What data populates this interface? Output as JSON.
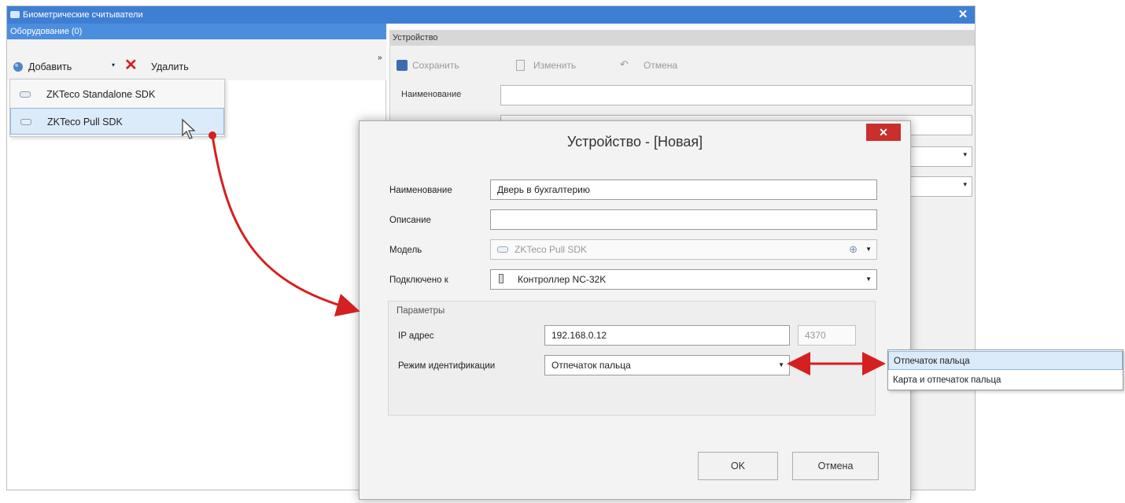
{
  "window": {
    "title": "Биометрические считыватели",
    "close_glyph": "✕"
  },
  "left_panel": {
    "header": "Оборудование (0)",
    "add_label": "Добавить",
    "delete_label": "Удалить",
    "overflow_glyph": "»",
    "menu_items": [
      {
        "label": "ZKTeco Standalone SDK",
        "icon": "device-icon"
      },
      {
        "label": "ZKTeco Pull SDK",
        "icon": "device-icon"
      }
    ]
  },
  "right_panel": {
    "header": "Устройство",
    "save_label": "Сохранить",
    "edit_label": "Изменить",
    "cancel_label": "Отмена",
    "name_label": "Наименование"
  },
  "dialog": {
    "title": "Устройство -  [Новая]",
    "close_glyph": "✕",
    "name_label": "Наименование",
    "name_value": "Дверь в бухгалтерию",
    "description_label": "Описание",
    "description_value": "",
    "model_label": "Модель",
    "model_value": "ZKTeco Pull SDK",
    "connected_label": "Подключено к",
    "connected_value": "Контроллер NC-32K",
    "params_label": "Параметры",
    "ip_label": "IP адрес",
    "ip_value": "192.168.0.12",
    "port_value": "4370",
    "mode_label": "Режим идентификации",
    "mode_value": "Отпечаток пальца",
    "ok_label": "OK",
    "cancel_label": "Отмена"
  },
  "ident_options": [
    {
      "label": "Отпечаток пальца",
      "selected": true
    },
    {
      "label": "Карта и отпечаток пальца",
      "selected": false
    }
  ],
  "colors": {
    "title_bar": "#3f7fd3",
    "accent_arrow": "#d42020",
    "close_button": "#c9302c"
  }
}
